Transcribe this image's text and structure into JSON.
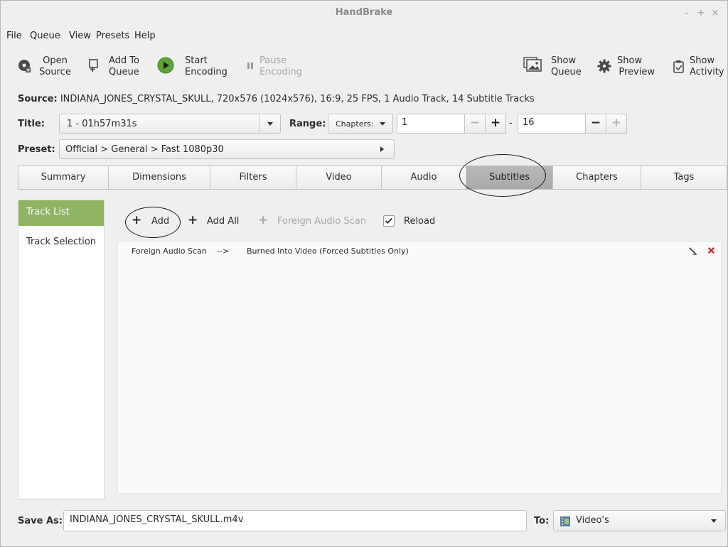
{
  "window": {
    "title": "HandBrake",
    "controls": {
      "minimize": "–",
      "maximize": "+",
      "close": "×"
    }
  },
  "menubar": [
    "File",
    "Queue",
    "View",
    "Presets",
    "Help"
  ],
  "toolbar": {
    "open_source": [
      "Open",
      "Source"
    ],
    "add_to_queue": [
      "Add To",
      "Queue"
    ],
    "start_encoding": [
      "Start",
      "Encoding"
    ],
    "pause_encoding": [
      "Pause",
      "Encoding"
    ],
    "show_queue": [
      "Show",
      "Queue"
    ],
    "show_preview": [
      "Show",
      "Preview"
    ],
    "show_activity": [
      "Show",
      "Activity"
    ]
  },
  "source": {
    "label": "Source:",
    "value": " INDIANA_JONES_CRYSTAL_SKULL, 720x576 (1024x576), 16:9, 25 FPS, 1 Audio Track, 14 Subtitle Tracks"
  },
  "title_row": {
    "title_label": "Title:",
    "title_value": "1 - 01h57m31s",
    "range_label": "Range:",
    "range_mode": "Chapters:",
    "range_start": "1",
    "range_sep": "-",
    "range_end": "16",
    "minus": "−",
    "plus": "+"
  },
  "preset": {
    "label": "Preset:",
    "value": "Official > General > Fast 1080p30"
  },
  "tabs": [
    "Summary",
    "Dimensions",
    "Filters",
    "Video",
    "Audio",
    "Subtitles",
    "Chapters",
    "Tags"
  ],
  "active_tab": "Subtitles",
  "sidebar": {
    "items": [
      "Track List",
      "Track Selection"
    ],
    "selected": "Track List"
  },
  "subtitle_toolbar": {
    "add": "Add",
    "add_all": "Add All",
    "foreign_audio_scan": "Foreign Audio Scan",
    "reload": "Reload",
    "reload_checked": true
  },
  "tracks": [
    {
      "source": "Foreign Audio Scan",
      "arrow": "-->",
      "destination": "Burned Into Video (Forced Subtitles Only)"
    }
  ],
  "save": {
    "label": "Save As:",
    "filename": "INDIANA_JONES_CRYSTAL_SKULL.m4v",
    "to_label": "To:",
    "destination": "Video's"
  },
  "colors": {
    "selected_sidebar": "#8fb464",
    "active_tab": "#b0b0b0",
    "start_icon": "#5aa536",
    "delete_icon": "#d0211c"
  }
}
